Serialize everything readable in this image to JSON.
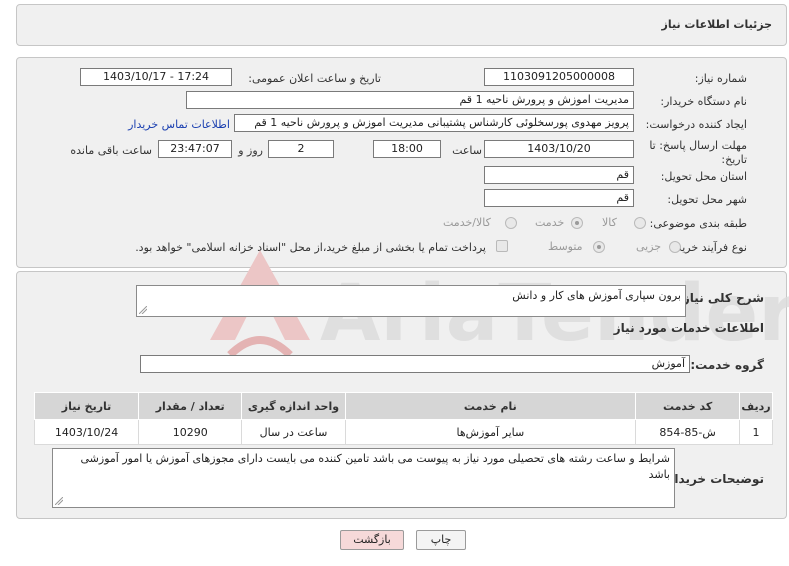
{
  "header": {
    "title": "جزئیات اطلاعات نیاز"
  },
  "fields": {
    "need_number_label": "شماره نیاز:",
    "need_number": "1103091205000008",
    "announce_label": "تاریخ و ساعت اعلان عمومی:",
    "announce_value": "1403/10/17 - 17:24",
    "buyer_org_label": "نام دستگاه خریدار:",
    "buyer_org": "مدیریت اموزش و پرورش ناحیه 1 قم",
    "creator_label": "ایجاد کننده درخواست:",
    "creator": "پرویز مهدوی پورسخلوئی کارشناس پشتیبانی مدیریت اموزش و پرورش ناحیه 1 قم",
    "contact_link": "اطلاعات تماس خریدار",
    "deadline_label": "مهلت ارسال پاسخ: تا تاریخ:",
    "deadline_date": "1403/10/20",
    "time_label": "ساعت",
    "deadline_time": "18:00",
    "days_value": "2",
    "days_label": "روز و",
    "remaining_time": "23:47:07",
    "remaining_label": "ساعت باقی مانده",
    "province_label": "استان محل تحویل:",
    "province": "قم",
    "city_label": "شهر محل تحویل:",
    "city": "قم",
    "category_label": "طبقه بندی موضوعی:",
    "category_options": [
      "کالا",
      "خدمت",
      "کالا/خدمت"
    ],
    "process_label": "نوع فرآیند خرید :",
    "process_options": [
      "جزیی",
      "متوسط"
    ],
    "payment_note": "پرداخت تمام یا بخشی از مبلغ خرید،از محل \"اسناد خزانه اسلامی\" خواهد بود."
  },
  "summary": {
    "label": "شرح کلی نیاز:",
    "value": "برون سپاری آموزش های کار و دانش"
  },
  "services": {
    "section_title": "اطلاعات خدمات مورد نیاز",
    "group_label": "گروه خدمت:",
    "group_value": "آموزش",
    "columns": [
      "ردیف",
      "کد خدمت",
      "نام خدمت",
      "واحد اندازه گیری",
      "تعداد / مقدار",
      "تاریخ نیاز"
    ],
    "rows": [
      [
        "1",
        "ش-85-854",
        "سایر آموزش‌ها",
        "ساعت در سال",
        "10290",
        "1403/10/24"
      ]
    ]
  },
  "buyer_notes": {
    "label": "توضیحات خریدار:",
    "value": "شرایط و ساعت رشته های تحصیلی مورد نیاز به پیوست می باشد تامین کننده می بایست دارای مجوزهای آموزش یا امور آموزشی باشد"
  },
  "buttons": {
    "print": "چاپ",
    "back": "بازگشت"
  },
  "watermark": {
    "text": "AriaTender.neT"
  },
  "colors": {
    "link": "#1a3fb0",
    "back_button": "#f6d9d9",
    "watermark": "#d8d8d8",
    "watermark_red": "#e9c3c3"
  }
}
